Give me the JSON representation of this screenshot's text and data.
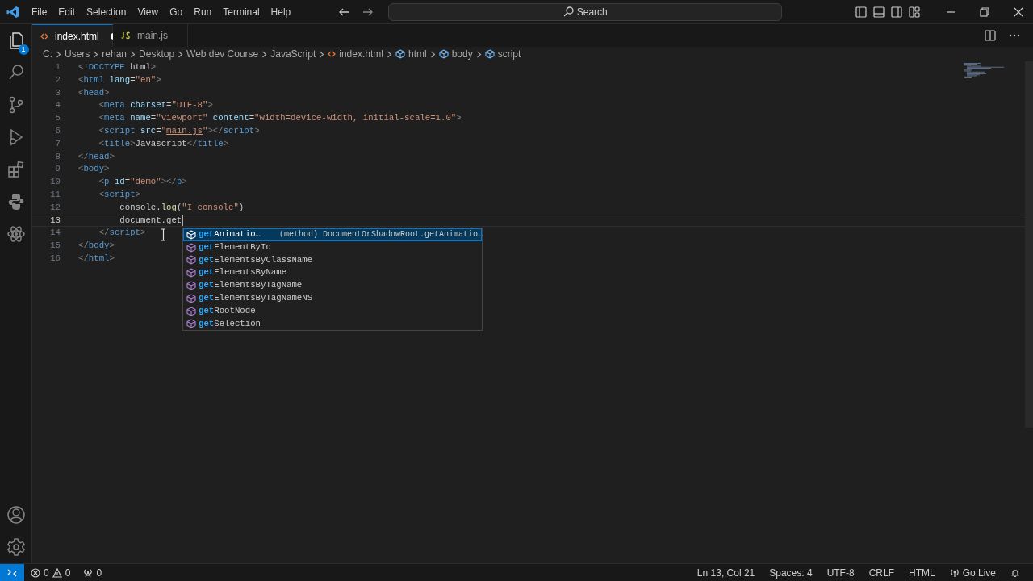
{
  "menu": [
    "File",
    "Edit",
    "Selection",
    "View",
    "Go",
    "Run",
    "Terminal",
    "Help"
  ],
  "command_center": {
    "label": "Search"
  },
  "activity_bar": {
    "explorer_badge": "1"
  },
  "tabs": [
    {
      "label": "index.html",
      "kind": "html",
      "selected": true,
      "modified": true
    },
    {
      "label": "main.js",
      "kind": "js",
      "selected": false,
      "modified": false
    }
  ],
  "breadcrumb": [
    {
      "label": "C:",
      "kind": "folder"
    },
    {
      "label": "Users",
      "kind": "folder"
    },
    {
      "label": "rehan",
      "kind": "folder"
    },
    {
      "label": "Desktop",
      "kind": "folder"
    },
    {
      "label": "Web dev Course",
      "kind": "folder"
    },
    {
      "label": "JavaScript",
      "kind": "folder"
    },
    {
      "label": "index.html",
      "kind": "file"
    },
    {
      "label": "html",
      "kind": "element"
    },
    {
      "label": "body",
      "kind": "element"
    },
    {
      "label": "script",
      "kind": "element"
    }
  ],
  "editor": {
    "lines": [
      {
        "number": "1",
        "current": false,
        "tokens": [
          {
            "kind": "punct",
            "text": "<!"
          },
          {
            "kind": "tag",
            "text": "DOCTYPE"
          },
          {
            "kind": "plain",
            "text": " html"
          },
          {
            "kind": "punct",
            "text": ">"
          }
        ]
      },
      {
        "number": "2",
        "current": false,
        "tokens": [
          {
            "kind": "punct",
            "text": "<"
          },
          {
            "kind": "tag",
            "text": "html"
          },
          {
            "kind": "attr",
            "text": " lang"
          },
          {
            "kind": "plain",
            "text": "="
          },
          {
            "kind": "str",
            "text": "\"en\""
          },
          {
            "kind": "punct",
            "text": ">"
          }
        ]
      },
      {
        "number": "3",
        "current": false,
        "tokens": [
          {
            "kind": "punct",
            "text": "<"
          },
          {
            "kind": "tag",
            "text": "head"
          },
          {
            "kind": "punct",
            "text": ">"
          }
        ]
      },
      {
        "number": "4",
        "current": false,
        "tokens": [
          {
            "kind": "punct",
            "text": "    <"
          },
          {
            "kind": "tag",
            "text": "meta"
          },
          {
            "kind": "attr",
            "text": " charset"
          },
          {
            "kind": "plain",
            "text": "="
          },
          {
            "kind": "str",
            "text": "\"UTF-8\""
          },
          {
            "kind": "punct",
            "text": ">"
          }
        ]
      },
      {
        "number": "5",
        "current": false,
        "tokens": [
          {
            "kind": "punct",
            "text": "    <"
          },
          {
            "kind": "tag",
            "text": "meta"
          },
          {
            "kind": "attr",
            "text": " name"
          },
          {
            "kind": "plain",
            "text": "="
          },
          {
            "kind": "str",
            "text": "\"viewport\""
          },
          {
            "kind": "attr",
            "text": " content"
          },
          {
            "kind": "plain",
            "text": "="
          },
          {
            "kind": "str",
            "text": "\"width=device-width, initial-scale=1.0\""
          },
          {
            "kind": "punct",
            "text": ">"
          }
        ]
      },
      {
        "number": "6",
        "current": false,
        "tokens": [
          {
            "kind": "punct",
            "text": "    <"
          },
          {
            "kind": "tag",
            "text": "script"
          },
          {
            "kind": "attr",
            "text": " src"
          },
          {
            "kind": "plain",
            "text": "="
          },
          {
            "kind": "str",
            "text": "\""
          },
          {
            "kind": "link",
            "text": "main.js"
          },
          {
            "kind": "str",
            "text": "\""
          },
          {
            "kind": "punct",
            "text": "></"
          },
          {
            "kind": "tag",
            "text": "script"
          },
          {
            "kind": "punct",
            "text": ">"
          }
        ]
      },
      {
        "number": "7",
        "current": false,
        "tokens": [
          {
            "kind": "punct",
            "text": "    <"
          },
          {
            "kind": "tag",
            "text": "title"
          },
          {
            "kind": "punct",
            "text": ">"
          },
          {
            "kind": "plain",
            "text": "Javascript"
          },
          {
            "kind": "punct",
            "text": "</"
          },
          {
            "kind": "tag",
            "text": "title"
          },
          {
            "kind": "punct",
            "text": ">"
          }
        ]
      },
      {
        "number": "8",
        "current": false,
        "tokens": [
          {
            "kind": "punct",
            "text": "</"
          },
          {
            "kind": "tag",
            "text": "head"
          },
          {
            "kind": "punct",
            "text": ">"
          }
        ]
      },
      {
        "number": "9",
        "current": false,
        "tokens": [
          {
            "kind": "punct",
            "text": "<"
          },
          {
            "kind": "tag",
            "text": "body"
          },
          {
            "kind": "punct",
            "text": ">"
          }
        ]
      },
      {
        "number": "10",
        "current": false,
        "tokens": [
          {
            "kind": "punct",
            "text": "    <"
          },
          {
            "kind": "tag",
            "text": "p"
          },
          {
            "kind": "attr",
            "text": " id"
          },
          {
            "kind": "plain",
            "text": "="
          },
          {
            "kind": "str",
            "text": "\"demo\""
          },
          {
            "kind": "punct",
            "text": "></"
          },
          {
            "kind": "tag",
            "text": "p"
          },
          {
            "kind": "punct",
            "text": ">"
          }
        ]
      },
      {
        "number": "11",
        "current": false,
        "tokens": [
          {
            "kind": "punct",
            "text": "    <"
          },
          {
            "kind": "tag",
            "text": "script"
          },
          {
            "kind": "punct",
            "text": ">"
          }
        ]
      },
      {
        "number": "12",
        "current": false,
        "tokens": [
          {
            "kind": "plain",
            "text": "        console."
          },
          {
            "kind": "fn",
            "text": "log"
          },
          {
            "kind": "plain",
            "text": "("
          },
          {
            "kind": "str",
            "text": "\"I console\""
          },
          {
            "kind": "plain",
            "text": ")"
          }
        ]
      },
      {
        "number": "13",
        "current": true,
        "tokens": [
          {
            "kind": "plain",
            "text": "        document.get"
          }
        ]
      },
      {
        "number": "14",
        "current": false,
        "tokens": [
          {
            "kind": "punct",
            "text": "    </"
          },
          {
            "kind": "tag",
            "text": "script"
          },
          {
            "kind": "punct",
            "text": ">"
          }
        ]
      },
      {
        "number": "15",
        "current": false,
        "tokens": [
          {
            "kind": "punct",
            "text": "</"
          },
          {
            "kind": "tag",
            "text": "body"
          },
          {
            "kind": "punct",
            "text": ">"
          }
        ]
      },
      {
        "number": "16",
        "current": false,
        "tokens": [
          {
            "kind": "punct",
            "text": "</"
          },
          {
            "kind": "tag",
            "text": "html"
          },
          {
            "kind": "punct",
            "text": ">"
          }
        ]
      }
    ]
  },
  "suggestions": [
    {
      "match": "get",
      "rest": "Animatio…",
      "detail": "(method) DocumentOrShadowRoot.getAnimatio…",
      "selected": true
    },
    {
      "match": "get",
      "rest": "ElementById",
      "selected": false
    },
    {
      "match": "get",
      "rest": "ElementsByClassName",
      "selected": false
    },
    {
      "match": "get",
      "rest": "ElementsByName",
      "selected": false
    },
    {
      "match": "get",
      "rest": "ElementsByTagName",
      "selected": false
    },
    {
      "match": "get",
      "rest": "ElementsByTagNameNS",
      "selected": false
    },
    {
      "match": "get",
      "rest": "RootNode",
      "selected": false
    },
    {
      "match": "get",
      "rest": "Selection",
      "selected": false
    }
  ],
  "status_bar": {
    "errors": "0",
    "warnings": "0",
    "ports": "0",
    "position": "Ln 13, Col 21",
    "indentation": "Spaces: 4",
    "encoding": "UTF-8",
    "eol": "CRLF",
    "language": "HTML",
    "go_live": "Go Live"
  }
}
